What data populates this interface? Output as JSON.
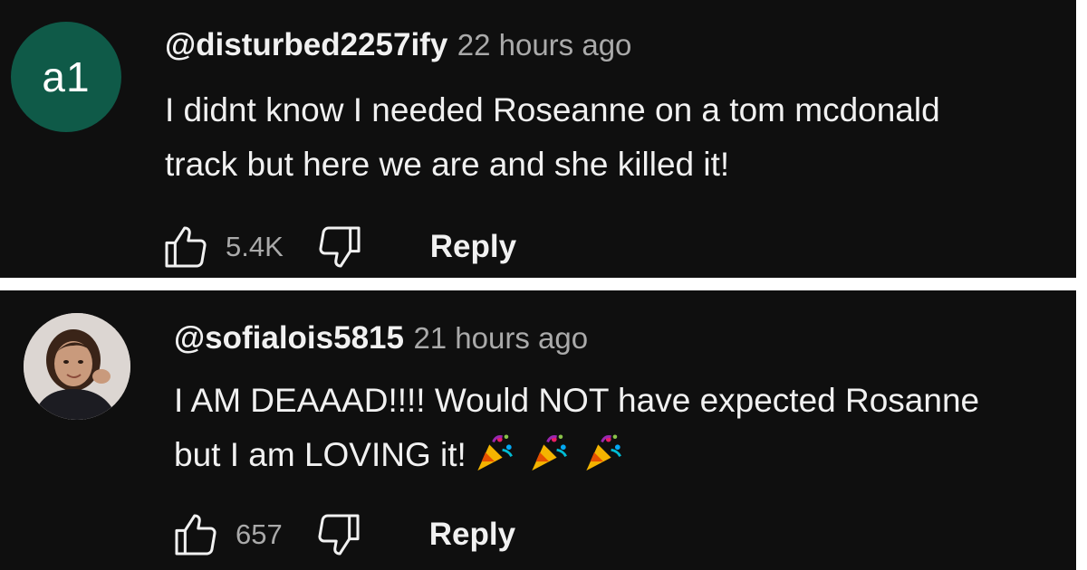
{
  "comments": [
    {
      "avatar_text": "a1",
      "avatar_color": "#0f5a48",
      "handle": "@disturbed2257ify",
      "time": "22 hours ago",
      "text_lines": [
        "I didnt know I needed Roseanne on a tom mcdonald",
        "track but here we are and she killed it!"
      ],
      "likes": "5.4K",
      "reply_label": "Reply"
    },
    {
      "avatar_text": "",
      "handle": "@sofialois5815",
      "time": "21 hours ago",
      "text_lines": [
        "I AM DEAAAD!!!! Would NOT have expected Rosanne",
        "but I am LOVING it!"
      ],
      "emoji": [
        "party-popper-icon",
        "party-popper-icon",
        "party-popper-icon"
      ],
      "likes": "657",
      "reply_label": "Reply"
    }
  ],
  "colors": {
    "background": "#0f0f0f",
    "text": "#f1f1f1",
    "secondary_text": "#aaaaaa",
    "divider": "#ffffff"
  }
}
